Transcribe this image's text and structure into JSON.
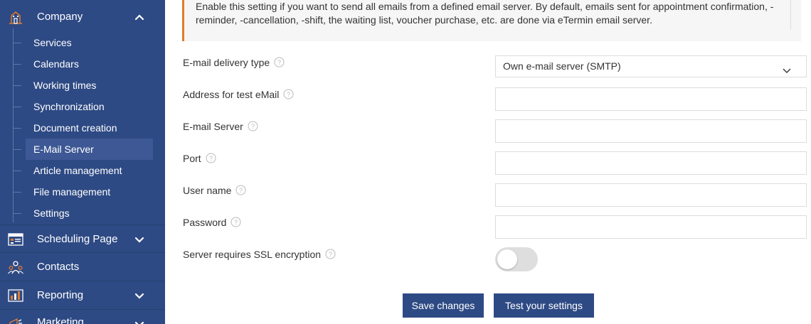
{
  "sidebar": {
    "sections": [
      {
        "label": "Company",
        "icon": "building-icon",
        "expanded": true
      },
      {
        "label": "Scheduling Page",
        "icon": "calendar-page-icon",
        "expanded": false
      },
      {
        "label": "Contacts",
        "icon": "people-icon",
        "expanded": false
      },
      {
        "label": "Reporting",
        "icon": "chart-report-icon",
        "expanded": false
      },
      {
        "label": "Marketing",
        "icon": "megaphone-icon",
        "expanded": false
      }
    ],
    "company_items": [
      {
        "label": "Services"
      },
      {
        "label": "Calendars"
      },
      {
        "label": "Working times"
      },
      {
        "label": "Synchronization"
      },
      {
        "label": "Document creation"
      },
      {
        "label": "E-Mail Server",
        "active": true
      },
      {
        "label": "Article management"
      },
      {
        "label": "File management"
      },
      {
        "label": "Settings"
      }
    ]
  },
  "notice": {
    "text": "Enable this setting if you want to send all emails from a defined email server. By default, emails sent for appointment confirmation, -reminder, -cancellation, -shift, the waiting list, voucher purchase, etc. are done via eTermin email server."
  },
  "form": {
    "delivery_type": {
      "label": "E-mail delivery type",
      "value": "Own e-mail server (SMTP)"
    },
    "test_address": {
      "label": "Address for test eMail",
      "value": ""
    },
    "email_server": {
      "label": "E-mail Server",
      "value": ""
    },
    "port": {
      "label": "Port",
      "value": ""
    },
    "username": {
      "label": "User name",
      "value": ""
    },
    "password": {
      "label": "Password",
      "value": ""
    },
    "ssl": {
      "label": "Server requires SSL encryption",
      "enabled": false
    }
  },
  "buttons": {
    "save": "Save changes",
    "test": "Test your settings"
  },
  "colors": {
    "sidebar_bg": "#2e4a84",
    "accent": "#e07b2e",
    "button_bg": "#2e4a84",
    "toggle_off": "#dedede"
  }
}
